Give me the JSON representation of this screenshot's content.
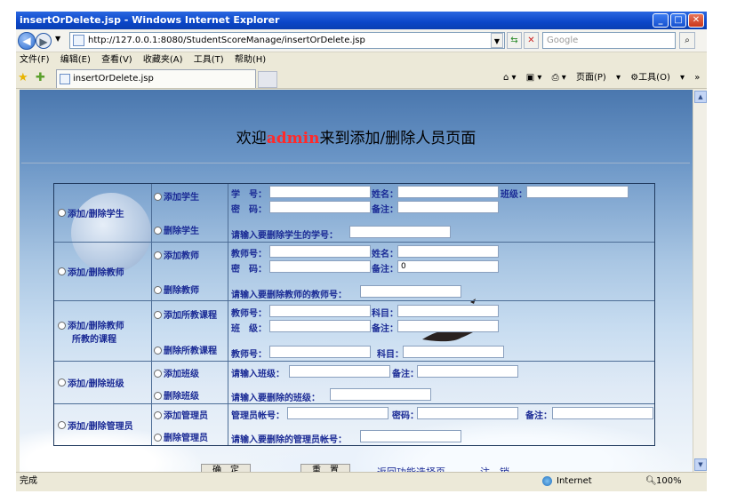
{
  "window": {
    "title": "insertOrDelete.jsp - Windows Internet Explorer"
  },
  "address": {
    "url": "http://127.0.0.1:8080/StudentScoreManage/insertOrDelete.jsp",
    "search_placeholder": "Google"
  },
  "menu": [
    "文件(F)",
    "编辑(E)",
    "查看(V)",
    "收藏夹(A)",
    "工具(T)",
    "帮助(H)"
  ],
  "tab": {
    "label": "insertOrDelete.jsp"
  },
  "toolbar": {
    "page": "页面(P)",
    "tools": "工具(O)"
  },
  "heading": {
    "pre": "欢迎",
    "user": "admin",
    "post": "来到添加/删除人员页面"
  },
  "sections": {
    "student": {
      "cat": "添加/删除学生",
      "add": "添加学生",
      "del": "删除学生",
      "f_id": "学　号：",
      "f_name": "姓名：",
      "f_class": "班级：",
      "f_pwd": "密　码：",
      "f_note": "备注：",
      "del_prompt": "请输入要删除学生的学号："
    },
    "teacher": {
      "cat": "添加/删除教师",
      "add": "添加教师",
      "del": "删除教师",
      "f_id": "教师号：",
      "f_name": "姓名：",
      "f_pwd": "密　码：",
      "f_note": "备注：",
      "note_value": "0",
      "del_prompt": "请输入要删除教师的教师号："
    },
    "course": {
      "cat1": "添加/删除教师",
      "cat2": "所教的课程",
      "add": "添加所教课程",
      "del": "删除所教课程",
      "f_tid": "教师号：",
      "f_subject": "科目：",
      "f_class": "班　级：",
      "f_note": "备注：",
      "d_tid": "教师号：",
      "d_subject": "科目："
    },
    "klass": {
      "cat": "添加/删除班级",
      "add": "添加班级",
      "del": "删除班级",
      "f_class": "请输入班级：",
      "f_note": "备注：",
      "del_prompt": "请输入要删除的班级："
    },
    "admin": {
      "cat": "添加/删除管理员",
      "add": "添加管理员",
      "del": "删除管理员",
      "f_acct": "管理员帐号：",
      "f_pwd": "密码：",
      "f_note": "备注：",
      "del_prompt": "请输入要删除的管理员帐号："
    }
  },
  "buttons": {
    "ok": "确　定",
    "reset": "重　置",
    "back": "返回功能选择页",
    "logout": "注　销"
  },
  "status": {
    "left": "完成",
    "zone": "Internet",
    "zoom": "100%"
  }
}
